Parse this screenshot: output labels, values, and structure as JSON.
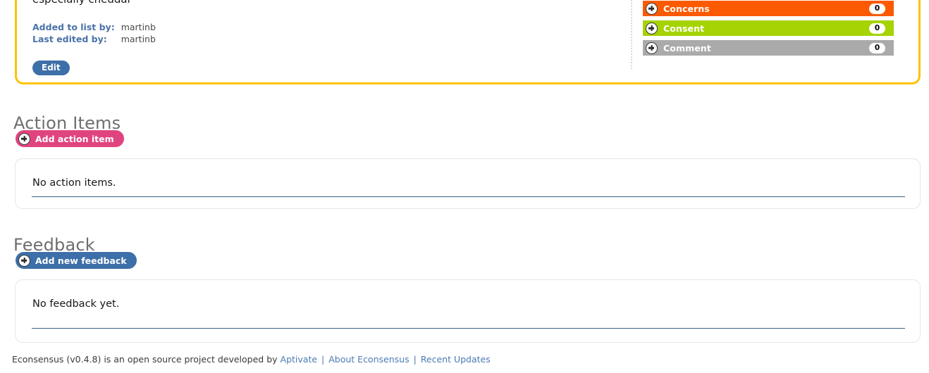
{
  "decision": {
    "description": "especially cheddar",
    "added_by_label": "Added to list by:",
    "added_by_value": "martinb",
    "last_edited_label": "Last edited by:",
    "last_edited_value": "martinb",
    "edit_button": "Edit",
    "border_color": "#fdc300"
  },
  "responses": [
    {
      "label": "Concerns",
      "count": "0",
      "color": "#fc5a02",
      "icon": "plus-circle-icon"
    },
    {
      "label": "Consent",
      "count": "0",
      "color": "#a5d303",
      "icon": "plus-circle-icon"
    },
    {
      "label": "Comment",
      "count": "0",
      "color": "#aaaaaa",
      "icon": "plus-circle-icon"
    }
  ],
  "action_items": {
    "heading": "Action Items",
    "add_button": "Add action item",
    "add_button_color": "#e0447e",
    "empty_text": "No action items."
  },
  "feedback": {
    "heading": "Feedback",
    "add_button": "Add new feedback",
    "add_button_color": "#3d6fa8",
    "empty_text": "No feedback yet."
  },
  "footer": {
    "text": "Econsensus (v0.4.8) is an open source project developed by",
    "links": [
      "Aptivate",
      "About Econsensus",
      "Recent Updates"
    ],
    "separator": "|",
    "link_color": "#4a7bb5"
  }
}
